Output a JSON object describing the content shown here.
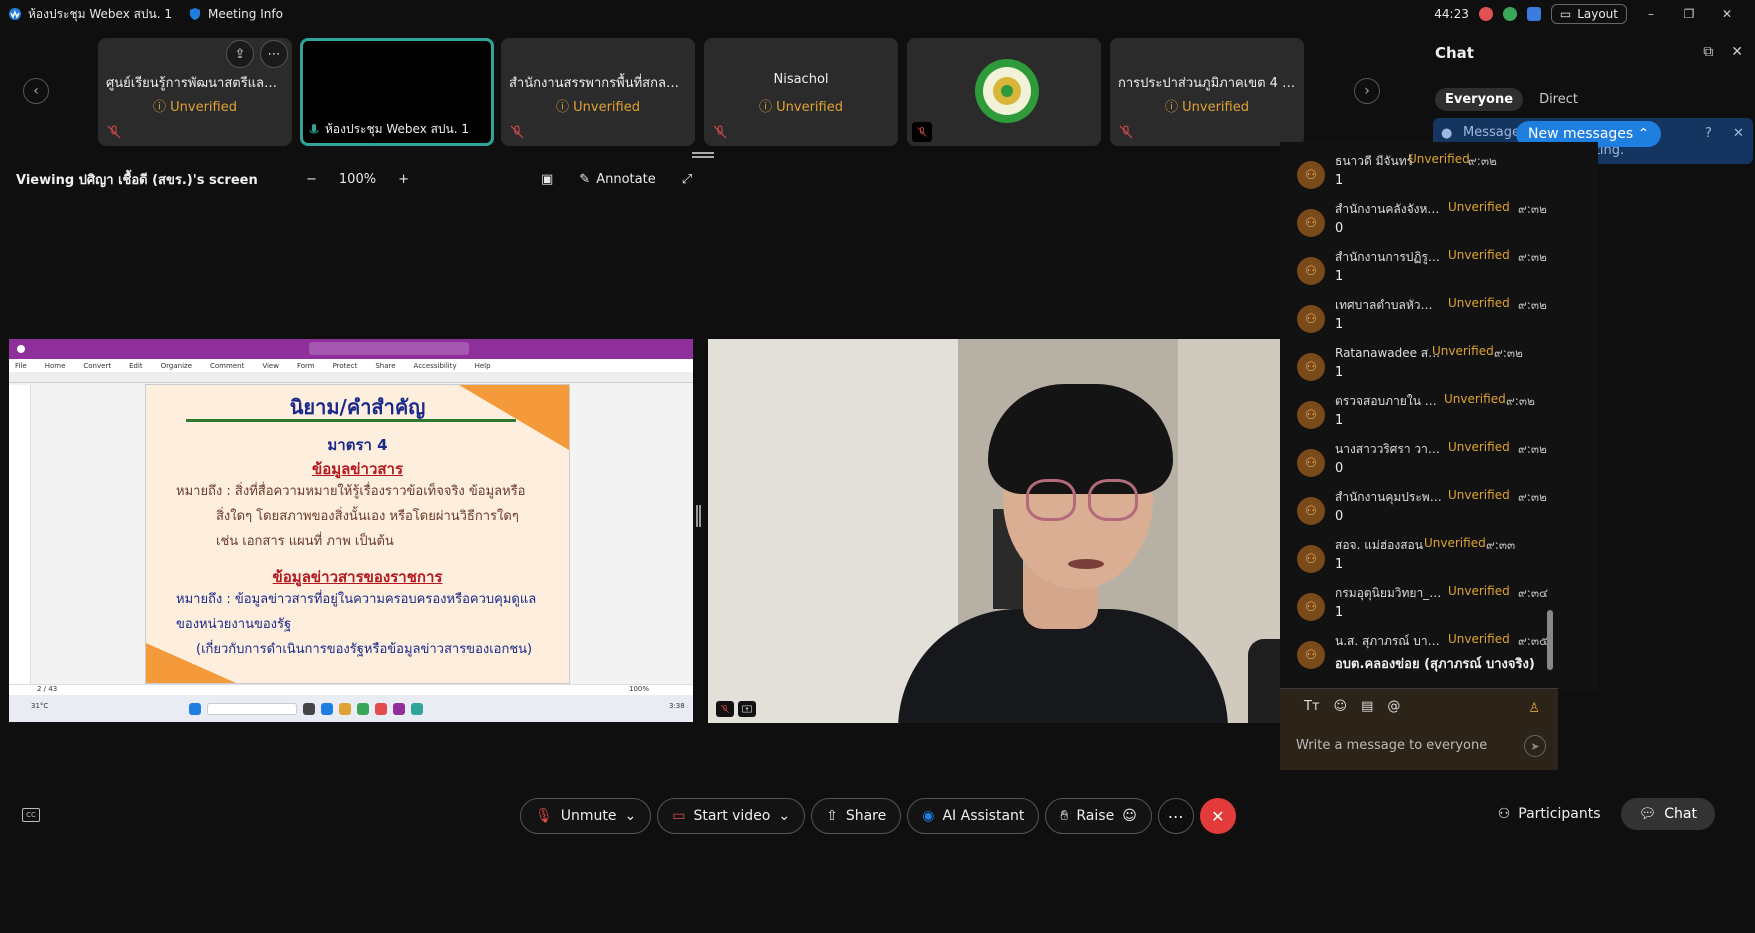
{
  "window": {
    "title": "ห้องประชุม Webex สปน. 1",
    "meeting_info": "Meeting Info",
    "timer": "44:23",
    "layout": "Layout"
  },
  "participants_strip": [
    {
      "name": "ศูนย์เรียนรู้การพัฒนาสตรีและค...",
      "status": "Unverified"
    },
    {
      "name": "ห้องประชุม Webex สปน. 1",
      "status": ""
    },
    {
      "name": "สำนักงานสรรพากรพื้นที่สกลนคร",
      "status": "Unverified"
    },
    {
      "name": "Nisachol",
      "status": "Unverified"
    },
    {
      "name": "",
      "status": ""
    },
    {
      "name": "การประปาส่วนภูมิภาคเขต 4 (นิ...",
      "status": "Unverified"
    }
  ],
  "viewbar": {
    "title": "Viewing ปศิญา เชื้อดี (สขร.)'s screen",
    "zoom": "100%",
    "annotate": "Annotate"
  },
  "shared_slide": {
    "heading": "นิยาม/คำสำคัญ",
    "section": "มาตรา 4",
    "sub1": "ข้อมูลข่าวสาร",
    "def1_a": "หมายถึง : สิ่งที่สื่อความหมายให้รู้เรื่องราวข้อเท็จจริง ข้อมูลหรือ",
    "def1_b": "สิ่งใดๆ โดยสภาพของสิ่งนั้นเอง หรือโดยผ่านวิธีการใดๆ",
    "def1_c": "เช่น เอกสาร แผนที่ ภาพ เป็นต้น",
    "sub2": "ข้อมูลข่าวสารของราชการ",
    "def2_a": "หมายถึง : ข้อมูลข่าวสารที่อยู่ในความครอบครองหรือควบคุมดูแล",
    "def2_b": "ของหน่วยงานของรัฐ",
    "def2_c": "(เกี่ยวกับการดำเนินการของรัฐหรือข้อมูลข่าวสารของเอกชน)",
    "menu": [
      "File",
      "Home",
      "Convert",
      "Edit",
      "Organize",
      "Comment",
      "View",
      "Form",
      "Protect",
      "Share",
      "Accessibility",
      "Help"
    ],
    "page": "2 / 43",
    "zoom": "100%",
    "weather": "31°C",
    "clock": "3:38"
  },
  "chat": {
    "title": "Chat",
    "tabs": {
      "everyone": "Everyone",
      "direct": "Direct"
    },
    "banner_text_a": "Message",
    "banner_text_b": "saved after the meeting.",
    "new_messages": "New messages",
    "messages": [
      {
        "name": "ธนาวดี มีจันทร์",
        "status": "Unverified",
        "time": "๙:๓๒",
        "text": "1"
      },
      {
        "name": "สำนักงานคลังจังหวัด...",
        "status": "Unverified",
        "time": "๙:๓๒",
        "text": "0"
      },
      {
        "name": "สำนักงานการปฏิรูปที่...",
        "status": "Unverified",
        "time": "๙:๓๒",
        "text": "1"
      },
      {
        "name": "เทศบาลตำบลหัวสำโ...",
        "status": "Unverified",
        "time": "๙:๓๒",
        "text": "1"
      },
      {
        "name": "Ratanawadee สอค.",
        "status": "Unverified",
        "time": "๙:๓๒",
        "text": "1"
      },
      {
        "name": "ตรวจสอบภายใน สอค.",
        "status": "Unverified",
        "time": "๙:๓๒",
        "text": "1"
      },
      {
        "name": "นางสาววริศรา วายุแ...",
        "status": "Unverified",
        "time": "๙:๓๒",
        "text": "0"
      },
      {
        "name": "สำนักงานคุมประพฤติ...",
        "status": "Unverified",
        "time": "๙:๓๒",
        "text": "0"
      },
      {
        "name": "สอจ. แม่ฮ่องสอน",
        "status": "Unverified",
        "time": "๙:๓๓",
        "text": "1"
      },
      {
        "name": "กรมอุตุนิยมวิทยา_(สร...",
        "status": "Unverified",
        "time": "๙:๓๔",
        "text": "1"
      },
      {
        "name": "น.ส. สุภาภรณ์ บางจ...",
        "status": "Unverified",
        "time": "๙:๓๕",
        "text": "อบต.คลองข่อย (สุภาภรณ์ บางจริง)"
      }
    ],
    "composer_placeholder": "Write a message to everyone"
  },
  "controls": {
    "unmute": "Unmute",
    "start_video": "Start video",
    "share": "Share",
    "ai_assistant": "AI Assistant",
    "raise": "Raise",
    "participants": "Participants",
    "chat": "Chat",
    "cc": "CC"
  },
  "colors": {
    "unverified": "#e0a235",
    "active_tile_border": "#2fa59a",
    "leave": "#e33b3b",
    "new_messages": "#1f7fe0"
  }
}
